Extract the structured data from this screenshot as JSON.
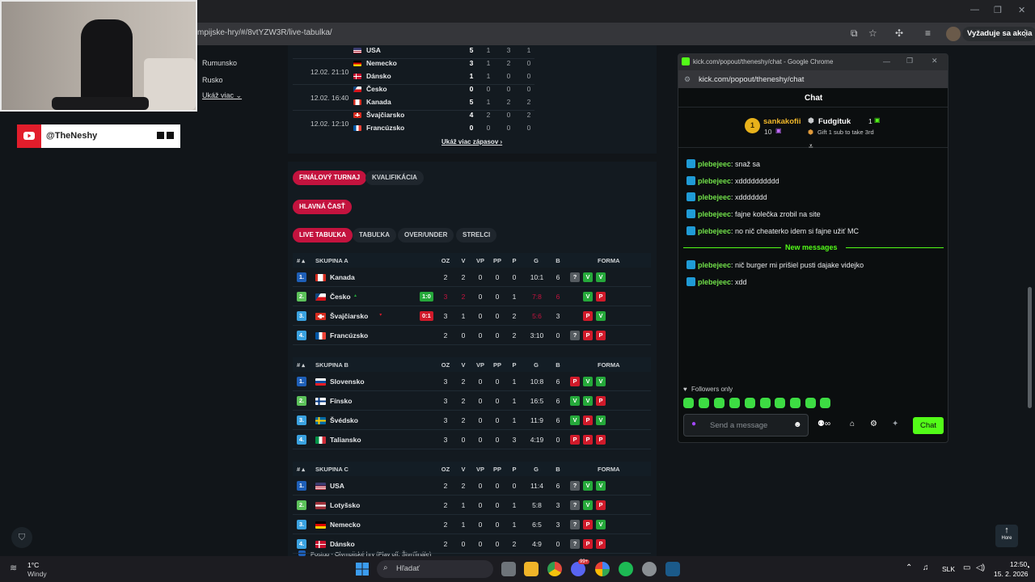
{
  "browser": {
    "url": "mpijske-hry/#/8vtYZW3R/live-tabulka/",
    "action_button": "Vyžaduje sa akcia"
  },
  "overlay": {
    "youtube_handle": "@TheNeshy"
  },
  "left_nav": {
    "items": [
      "Rumunsko",
      "Rusko"
    ],
    "show_more": "Ukáž viac"
  },
  "matches": {
    "rows": [
      {
        "date": "",
        "teams": [
          {
            "name": "USA",
            "flag": "us",
            "score": "5",
            "n": [
              "1",
              "3",
              "1"
            ]
          }
        ]
      },
      {
        "date": "12.02. 21:10",
        "teams": [
          {
            "name": "Nemecko",
            "flag": "de",
            "score": "3",
            "n": [
              "1",
              "2",
              "0"
            ]
          },
          {
            "name": "Dánsko",
            "flag": "dk",
            "score": "1",
            "n": [
              "1",
              "0",
              "0"
            ]
          }
        ]
      },
      {
        "date": "12.02. 16:40",
        "teams": [
          {
            "name": "Česko",
            "flag": "cz",
            "score": "0",
            "n": [
              "0",
              "0",
              "0"
            ]
          },
          {
            "name": "Kanada",
            "flag": "ca",
            "score": "5",
            "n": [
              "1",
              "2",
              "2"
            ]
          }
        ]
      },
      {
        "date": "12.02. 12:10",
        "teams": [
          {
            "name": "Švajčiarsko",
            "flag": "ch",
            "score": "4",
            "n": [
              "2",
              "0",
              "2"
            ]
          },
          {
            "name": "Francúzsko",
            "flag": "fr",
            "score": "0",
            "n": [
              "0",
              "0",
              "0"
            ]
          }
        ]
      }
    ],
    "show_more": "Ukáž viac zápasov"
  },
  "tabs1": [
    "FINÁLOVÝ TURNAJ",
    "KVALIFIKÁCIA"
  ],
  "tabs2": [
    "HLAVNÁ ČASŤ"
  ],
  "tabs3": [
    "LIVE TABUĽKA",
    "TABUĽKA",
    "OVER/UNDER",
    "STRELCI"
  ],
  "columns": {
    "hash": "#",
    "oz": "OZ",
    "v": "V",
    "vp": "VP",
    "pp": "PP",
    "p": "P",
    "g": "G",
    "b": "B",
    "forma": "FORMA"
  },
  "groups": [
    {
      "name": "SKUPINA A",
      "rows": [
        {
          "rank": "1.",
          "team": "Kanada",
          "flag": "ca",
          "oz": "2",
          "v": "2",
          "vp": "0",
          "pp": "0",
          "p": "0",
          "g": "10:1",
          "b": "6",
          "form": [
            "?",
            "V",
            "V"
          ],
          "live": ""
        },
        {
          "rank": "2.",
          "team": "Česko",
          "flag": "cz",
          "oz": "3",
          "v": "2",
          "vp": "0",
          "pp": "0",
          "p": "1",
          "g": "7:8",
          "b": "6",
          "form": [
            "V",
            "P"
          ],
          "live": "1:0",
          "lwin": true
        },
        {
          "rank": "3.",
          "team": "Švajčiarsko",
          "flag": "ch",
          "oz": "3",
          "v": "1",
          "vp": "0",
          "pp": "0",
          "p": "2",
          "g": "5:6",
          "b": "3",
          "form": [
            "P",
            "V"
          ],
          "live": "0:1",
          "lwin": false
        },
        {
          "rank": "4.",
          "team": "Francúzsko",
          "flag": "fr",
          "oz": "2",
          "v": "0",
          "vp": "0",
          "pp": "0",
          "p": "2",
          "g": "3:10",
          "b": "0",
          "form": [
            "?",
            "P",
            "P"
          ],
          "live": ""
        }
      ]
    },
    {
      "name": "SKUPINA B",
      "rows": [
        {
          "rank": "1.",
          "team": "Slovensko",
          "flag": "sk",
          "oz": "3",
          "v": "2",
          "vp": "0",
          "pp": "0",
          "p": "1",
          "g": "10:8",
          "b": "6",
          "form": [
            "P",
            "V",
            "V"
          ],
          "live": ""
        },
        {
          "rank": "2.",
          "team": "Fínsko",
          "flag": "fi",
          "oz": "3",
          "v": "2",
          "vp": "0",
          "pp": "0",
          "p": "1",
          "g": "16:5",
          "b": "6",
          "form": [
            "V",
            "V",
            "P"
          ],
          "live": ""
        },
        {
          "rank": "3.",
          "team": "Švédsko",
          "flag": "se",
          "oz": "3",
          "v": "2",
          "vp": "0",
          "pp": "0",
          "p": "1",
          "g": "11:9",
          "b": "6",
          "form": [
            "V",
            "P",
            "V"
          ],
          "live": ""
        },
        {
          "rank": "4.",
          "team": "Taliansko",
          "flag": "it",
          "oz": "3",
          "v": "0",
          "vp": "0",
          "pp": "0",
          "p": "3",
          "g": "4:19",
          "b": "0",
          "form": [
            "P",
            "P",
            "P"
          ],
          "live": ""
        }
      ]
    },
    {
      "name": "SKUPINA C",
      "rows": [
        {
          "rank": "1.",
          "team": "USA",
          "flag": "us",
          "oz": "2",
          "v": "2",
          "vp": "0",
          "pp": "0",
          "p": "0",
          "g": "11:4",
          "b": "6",
          "form": [
            "?",
            "V",
            "V"
          ],
          "live": ""
        },
        {
          "rank": "2.",
          "team": "Lotyšsko",
          "flag": "lv",
          "oz": "2",
          "v": "1",
          "vp": "0",
          "pp": "0",
          "p": "1",
          "g": "5:8",
          "b": "3",
          "form": [
            "?",
            "V",
            "P"
          ],
          "live": ""
        },
        {
          "rank": "3.",
          "team": "Nemecko",
          "flag": "de",
          "oz": "2",
          "v": "1",
          "vp": "0",
          "pp": "0",
          "p": "1",
          "g": "6:5",
          "b": "3",
          "form": [
            "?",
            "P",
            "V"
          ],
          "live": ""
        },
        {
          "rank": "4.",
          "team": "Dánsko",
          "flag": "dk",
          "oz": "2",
          "v": "0",
          "vp": "0",
          "pp": "0",
          "p": "2",
          "g": "4:9",
          "b": "0",
          "form": [
            "?",
            "P",
            "P"
          ],
          "live": ""
        }
      ]
    }
  ],
  "legend_text": "Postup - Olympijské hry (Play off: Štvrťfinále)",
  "kick": {
    "title": "kick.com/popout/theneshy/chat - Google Chrome",
    "url": "kick.com/popout/theneshy/chat",
    "heading": "Chat",
    "top_user": "sankakofii",
    "top_count": "10",
    "gift_user": "Fudgituk",
    "gift_count": "1",
    "gift_text": "Gift 1 sub to take 3rd",
    "messages": [
      {
        "user": "plebejeec",
        "text": "snaž sa"
      },
      {
        "user": "plebejeec",
        "text": "xdddddddddd"
      },
      {
        "user": "plebejeec",
        "text": "xddddddd"
      },
      {
        "user": "plebejeec",
        "text": "fajne kolečka zrobil na site"
      },
      {
        "user": "plebejeec",
        "text": "no nič cheaterko idem si fajne užiť MC"
      }
    ],
    "new_label": "New messages",
    "new_messages": [
      {
        "user": "plebejeec",
        "text": "nič burger mi prišiel pusti dajake videjko"
      },
      {
        "user": "plebejeec",
        "text": "xdd"
      }
    ],
    "followers_only": "Followers only",
    "placeholder": "Send a message",
    "chat_button": "Chat"
  },
  "scroll_top": "Hore",
  "taskbar": {
    "temp": "1°C",
    "weather": "Windy",
    "search": "Hľadať",
    "lang": "SLK",
    "time": "12:50",
    "date": "15. 2. 2026",
    "badge": "99+"
  }
}
